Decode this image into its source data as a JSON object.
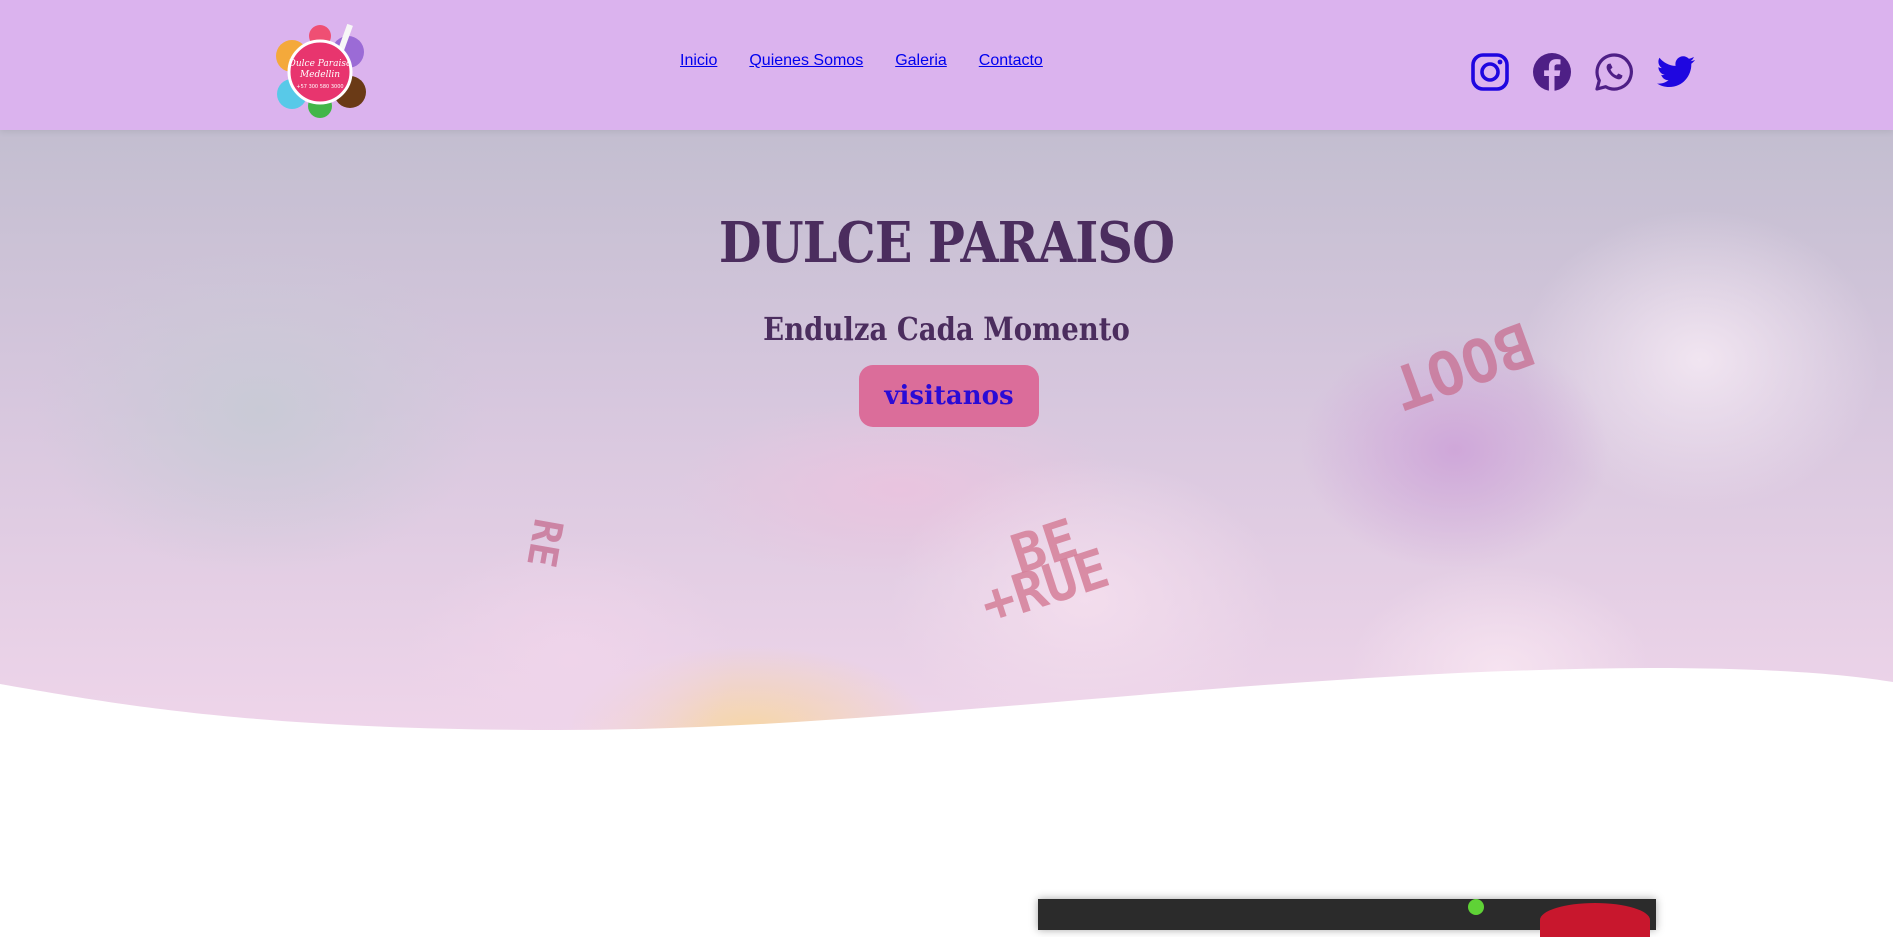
{
  "nav": {
    "logo_name": "Dulce Paraiso Medellin logo",
    "logo_text": {
      "line1": "Dulce Paraiso",
      "line2": "Medellin",
      "phone": "+57 300 580 3000"
    },
    "links": [
      "Inicio",
      "Quienes Somos",
      "Galeria",
      "Contacto"
    ],
    "social": [
      "instagram-icon",
      "facebook-icon",
      "whatsapp-icon",
      "twitter-icon"
    ]
  },
  "hero": {
    "title": "DULCE PARAISO",
    "subtitle": "Endulza Cada Momento",
    "button": "visitanos"
  },
  "colors": {
    "navbar": "#dbb3ee",
    "link": "#1f06e0",
    "heading": "#4b2d5e",
    "button_bg": "#db6d9a",
    "social_dark": "#4e1f86"
  }
}
